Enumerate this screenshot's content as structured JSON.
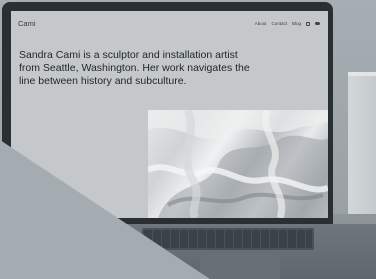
{
  "site": {
    "brand": "Cami",
    "nav": [
      "About",
      "Contact",
      "Blog"
    ],
    "social_icons": [
      "instagram-icon",
      "twitter-icon"
    ],
    "intro": "Sandra Cami is a sculptor and installation artist from Seattle, Washington. Her work navigates the line between history and subculture."
  },
  "colors": {
    "wall": "#9ea6ab",
    "screen_bg": "#c4c8ca",
    "text": "#1f2528",
    "bezel": "#2a2f33",
    "foreground": "#a4acb1"
  }
}
